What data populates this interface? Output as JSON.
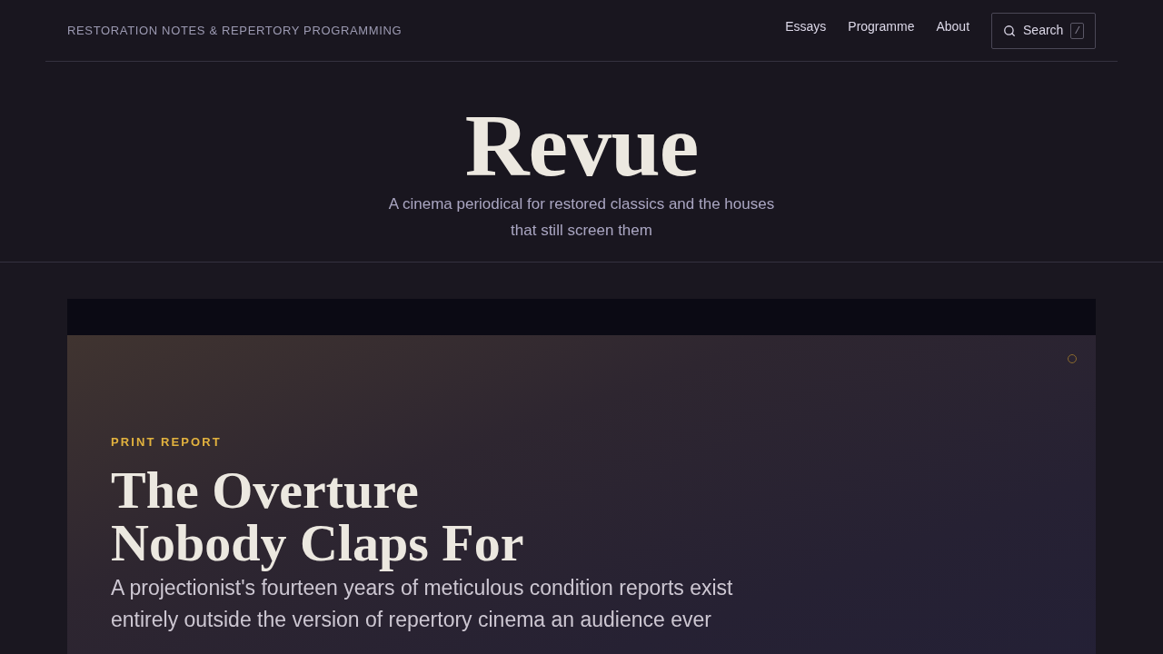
{
  "header": {
    "tagline": "RESTORATION NOTES & REPERTORY PROGRAMMING",
    "nav": [
      {
        "label": "Essays"
      },
      {
        "label": "Programme"
      },
      {
        "label": "About"
      }
    ],
    "search": {
      "label": "Search",
      "shortcut": "/"
    }
  },
  "masthead": {
    "title": "Revue",
    "subtitle": "A cinema periodical for restored classics and the houses that still screen them"
  },
  "feature": {
    "kicker": "PRINT REPORT",
    "title": "The Overture Nobody Claps For",
    "summary": "A projectionist's fourteen years of meticulous condition reports exist entirely outside the version of repertory cinema an audience ever"
  }
}
